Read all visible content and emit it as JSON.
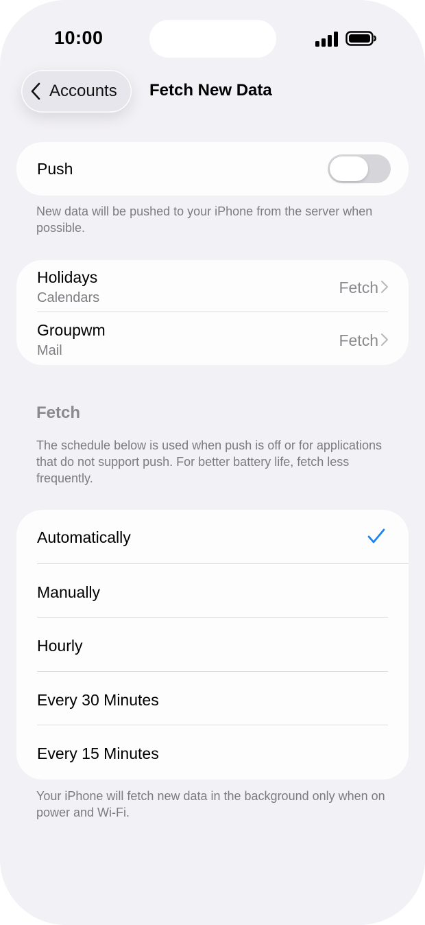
{
  "status_bar": {
    "time": "10:00",
    "icons": [
      "signal-icon",
      "battery-icon"
    ]
  },
  "nav": {
    "back_label": "Accounts",
    "title": "Fetch New Data"
  },
  "push": {
    "label": "Push",
    "enabled": false,
    "footer": "New data will be pushed to your iPhone from the server when possible."
  },
  "accounts": [
    {
      "name": "Holidays",
      "type": "Calendars",
      "value": "Fetch"
    },
    {
      "name": "Groupwm",
      "type": "Mail",
      "value": "Fetch"
    }
  ],
  "fetch": {
    "header": "Fetch",
    "description": "The schedule below is used when push is off or for applications that do not support push. For better battery life, fetch less frequently.",
    "options": [
      {
        "label": "Automatically",
        "selected": true
      },
      {
        "label": "Manually",
        "selected": false
      },
      {
        "label": "Hourly",
        "selected": false
      },
      {
        "label": "Every 30 Minutes",
        "selected": false
      },
      {
        "label": "Every 15 Minutes",
        "selected": false
      }
    ],
    "footer": "Your iPhone will fetch new data in the background only when on power and Wi-Fi."
  },
  "colors": {
    "accent": "#1a84f0",
    "background": "#f2f1f6",
    "toggle_off": "#d6d6da"
  }
}
